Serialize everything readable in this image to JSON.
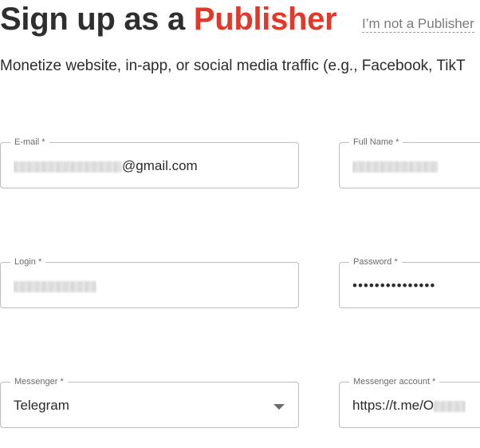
{
  "header": {
    "title_prefix": "Sign up as a ",
    "title_accent": "Publisher",
    "not_link": "I’m not a Publisher",
    "subtitle": "Monetize website, in-app, or social media traffic (e.g., Facebook, TikT"
  },
  "form": {
    "email": {
      "label": "E-mail *",
      "value_suffix": "@gmail.com"
    },
    "full_name": {
      "label": "Full Name *"
    },
    "login": {
      "label": "Login *"
    },
    "password": {
      "label": "Password *",
      "value": "•••••••••••••••"
    },
    "messenger": {
      "label": "Messenger *",
      "value": "Telegram"
    },
    "messenger_account": {
      "label": "Messenger account *",
      "value": "https://t.me/O"
    }
  },
  "colors": {
    "accent": "#e0392b",
    "border": "#bdbdbd"
  }
}
